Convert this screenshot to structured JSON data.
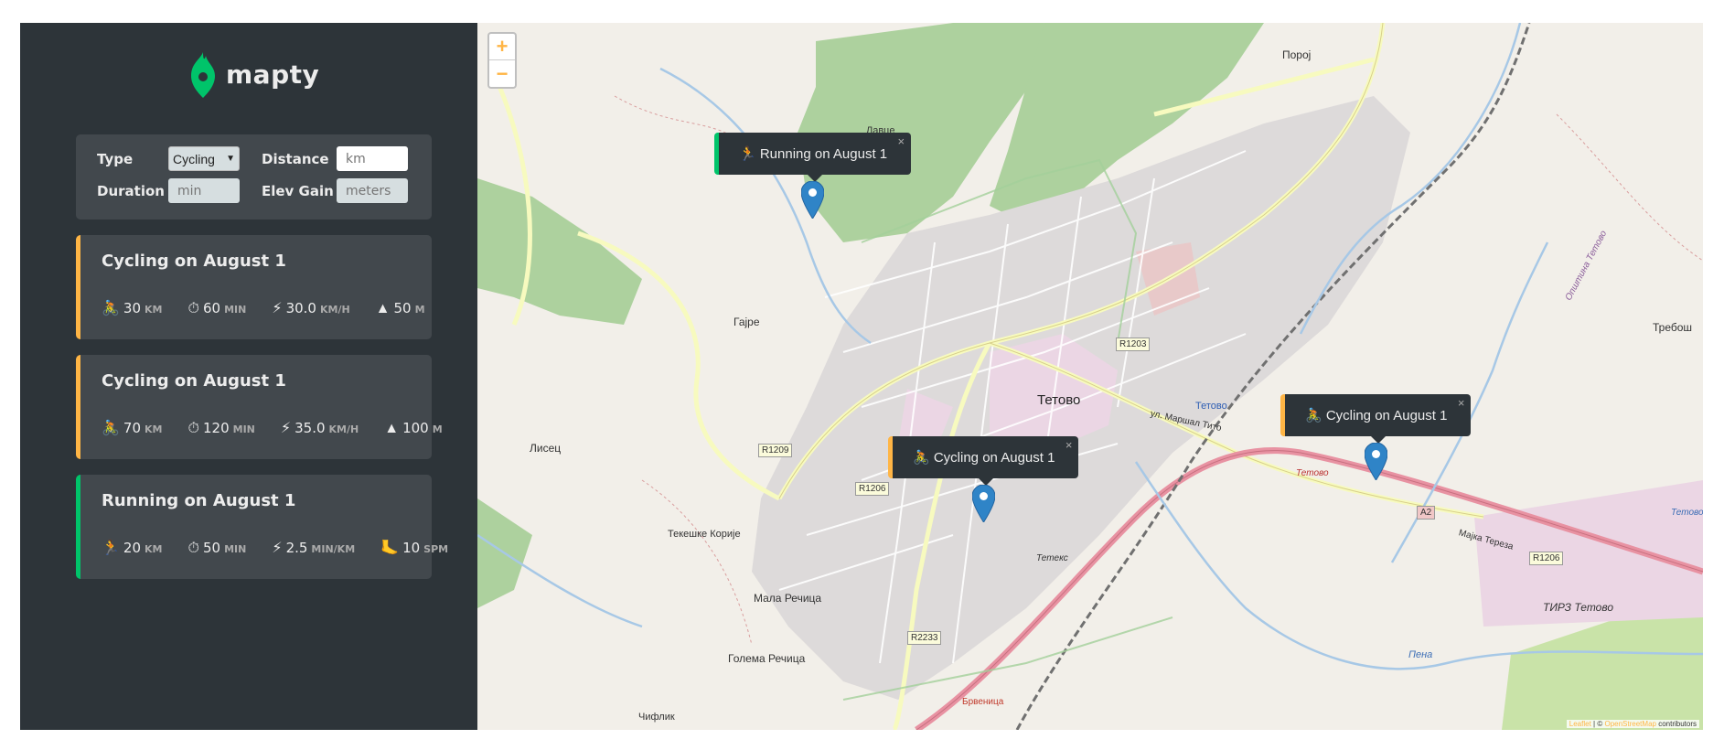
{
  "app": {
    "logo_text": "mapty"
  },
  "form": {
    "type_label": "Type",
    "type_value": "Cycling",
    "distance_label": "Distance",
    "distance_placeholder": "km",
    "duration_label": "Duration",
    "duration_placeholder": "min",
    "elev_label": "Elev Gain",
    "elev_placeholder": "meters"
  },
  "workouts": [
    {
      "kind": "cycling",
      "title": "Cycling on August 1",
      "distance": "30",
      "distance_unit": "km",
      "duration": "60",
      "duration_unit": "min",
      "speed": "30.0",
      "speed_unit": "km/h",
      "extra": "50",
      "extra_unit": "m",
      "icon": "🚴",
      "extra_icon": "▲"
    },
    {
      "kind": "cycling",
      "title": "Cycling on August 1",
      "distance": "70",
      "distance_unit": "km",
      "duration": "120",
      "duration_unit": "min",
      "speed": "35.0",
      "speed_unit": "km/h",
      "extra": "100",
      "extra_unit": "m",
      "icon": "🚴",
      "extra_icon": "▲"
    },
    {
      "kind": "running",
      "title": "Running on August 1",
      "distance": "20",
      "distance_unit": "km",
      "duration": "50",
      "duration_unit": "min",
      "speed": "2.5",
      "speed_unit": "min/km",
      "extra": "10",
      "extra_unit": "spm",
      "icon": "🏃",
      "extra_icon": "🦶"
    }
  ],
  "map": {
    "zoom_in": "+",
    "zoom_out": "−",
    "popups": [
      {
        "text": "🏃 Running on August 1",
        "kind": "running"
      },
      {
        "text": "🚴 Cycling on August 1",
        "kind": "cycling"
      },
      {
        "text": "🚴 Cycling on August 1",
        "kind": "cycling"
      }
    ],
    "close_glyph": "×",
    "places": {
      "tetovo": "Тетово",
      "poroj": "Порој",
      "gajre": "Гајре",
      "lisec": "Лисец",
      "tekeshke": "Текешке Корије",
      "mala_rechica": "Мала Речица",
      "golema_rechica": "Голема Речица",
      "chiflik": "Чифлик",
      "trebosh": "Требош",
      "tirz": "ТИРЗ Тетово",
      "brvenica": "Брвеница",
      "lavce": "Лавце",
      "tetovo_blue": "Тетово",
      "tetovo_road": "Тетово",
      "tetovo_east": "Тетово",
      "opshtina": "Општина Тетово",
      "majka_tereza": "Мајка Тереза",
      "marshal_tito": "ул. Маршал Тито",
      "pena": "Пена",
      "tetex": "Тетекс"
    },
    "shields": {
      "r1203": "R1203",
      "r1209": "R1209",
      "r1206a": "R1206",
      "r1206b": "R1206",
      "r2233": "R2233",
      "a2": "A2"
    },
    "attribution_leaflet": "Leaflet",
    "attribution_sep": "| ©",
    "attribution_osm": "OpenStreetMap",
    "attribution_contrib": "contributors"
  }
}
